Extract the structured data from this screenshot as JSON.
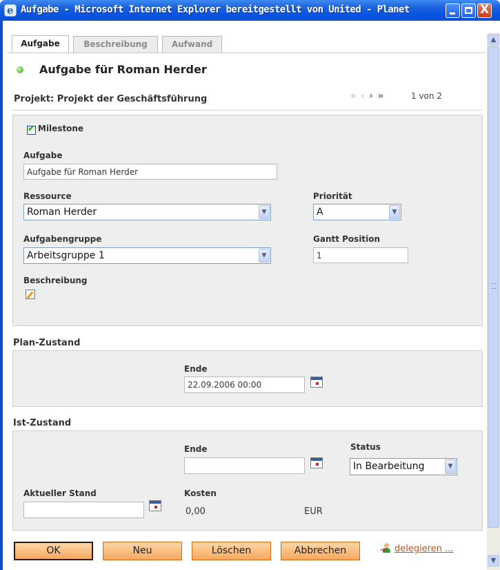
{
  "window": {
    "title": "Aufgabe - Microsoft Internet Explorer bereitgestellt von United - Planet",
    "close_glyph": "X"
  },
  "tabs": [
    {
      "label": "Aufgabe",
      "active": true
    },
    {
      "label": "Beschreibung",
      "active": false
    },
    {
      "label": "Aufwand",
      "active": false
    }
  ],
  "heading": "Aufgabe für Roman Herder",
  "project": {
    "label": "Projekt:  Projekt der Geschäftsführung",
    "pager": "1 von 2"
  },
  "form": {
    "milestone_label": "Milestone",
    "milestone_checked": true,
    "task_label": "Aufgabe",
    "task_value": "Aufgabe für Roman Herder",
    "resource_label": "Ressource",
    "resource_value": "Roman Herder",
    "priority_label": "Priorität",
    "priority_value": "A",
    "group_label": "Aufgabengruppe",
    "group_value": "Arbeitsgruppe 1",
    "gantt_label": "Gantt Position",
    "gantt_value": "1",
    "description_label": "Beschreibung"
  },
  "plan": {
    "title": "Plan-Zustand",
    "end_label": "Ende",
    "end_value": "22.09.2006 00:00"
  },
  "actual": {
    "title": "Ist-Zustand",
    "end_label": "Ende",
    "end_value": "",
    "status_label": "Status",
    "status_value": "In Bearbeitung",
    "progress_label": "Aktueller Stand",
    "progress_value": "",
    "cost_label": "Kosten",
    "cost_value": "0,00",
    "currency": "EUR"
  },
  "buttons": {
    "ok": "OK",
    "new": "Neu",
    "delete": "Löschen",
    "cancel": "Abbrechen",
    "delegate": "delegieren ..."
  },
  "colors": {
    "titlebar": "#0854e3",
    "button_fill": "#f6a85e",
    "section_bg": "#eeeeee",
    "link": "#c3541b"
  }
}
